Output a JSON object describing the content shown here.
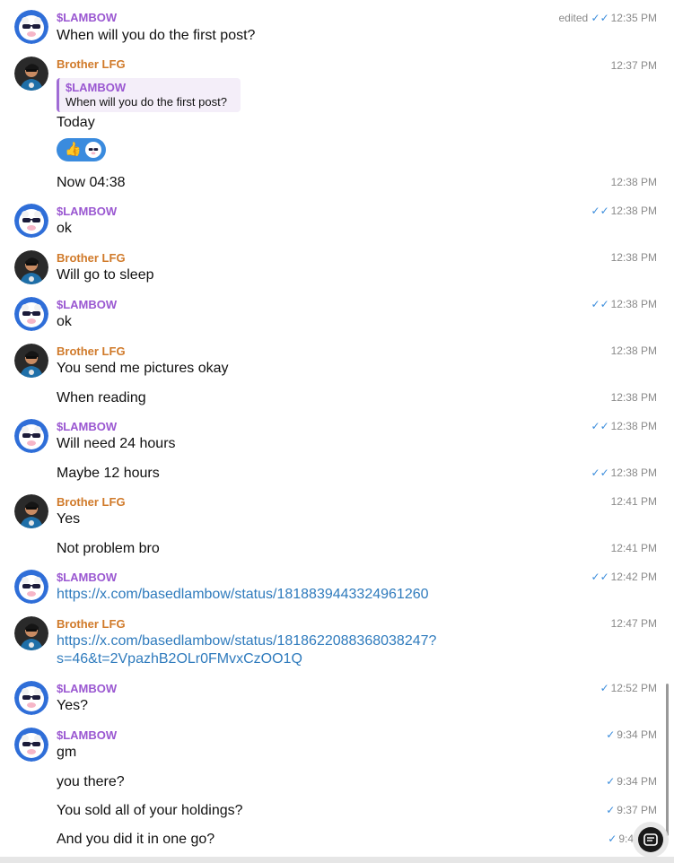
{
  "messages": [
    {
      "sender": "$LAMBOW",
      "text": "When will you do the first post?",
      "meta_prefix": "edited",
      "time": "12:35 PM",
      "check": "✓✓"
    },
    {
      "sender": "Brother LFG",
      "reply_sender": "$LAMBOW",
      "reply_text": "When will you do the first post?",
      "text": "Today",
      "time": "12:37 PM",
      "check": ""
    },
    {
      "text": "Now 04:38",
      "time": "12:38 PM",
      "check": ""
    },
    {
      "sender": "$LAMBOW",
      "text": "ok",
      "time": "12:38 PM",
      "check": "✓✓"
    },
    {
      "sender": "Brother LFG",
      "text": "Will go to sleep",
      "time": "12:38 PM",
      "check": ""
    },
    {
      "sender": "$LAMBOW",
      "text": "ok",
      "time": "12:38 PM",
      "check": "✓✓"
    },
    {
      "sender": "Brother LFG",
      "text": "You send me pictures okay",
      "time": "12:38 PM",
      "check": ""
    },
    {
      "text": "When reading",
      "time": "12:38 PM",
      "check": ""
    },
    {
      "sender": "$LAMBOW",
      "text": "Will need 24 hours",
      "time": "12:38 PM",
      "check": "✓✓"
    },
    {
      "text": "Maybe 12 hours",
      "time": "12:38 PM",
      "check": "✓✓"
    },
    {
      "sender": "Brother LFG",
      "text": "Yes",
      "time": "12:41 PM",
      "check": ""
    },
    {
      "text": "Not problem bro",
      "time": "12:41 PM",
      "check": ""
    },
    {
      "sender": "$LAMBOW",
      "text": "https://x.com/basedlambow/status/1818839443324961260",
      "time": "12:42 PM",
      "check": "✓✓"
    },
    {
      "sender": "Brother LFG",
      "text": "https://x.com/basedlambow/status/1818622088368038247?",
      "text2": "s=46&t=2VpazhB2OLr0FMvxCzOO1Q",
      "time": "12:47 PM",
      "check": ""
    },
    {
      "sender": "$LAMBOW",
      "text": "Yes?",
      "time": "12:52 PM",
      "check": "✓"
    },
    {
      "sender": "$LAMBOW",
      "text": "gm",
      "time": "9:34 PM",
      "check": "✓"
    },
    {
      "text": "you there?",
      "time": "9:34 PM",
      "check": "✓"
    },
    {
      "text": "You sold all of your holdings?",
      "time": "9:37 PM",
      "check": "✓"
    },
    {
      "text": "And you did it in one go?",
      "time": "9:4",
      "check": "✓"
    }
  ],
  "colors": {
    "lambow_name": "#9a57d1",
    "lfg_name": "#d07a2a",
    "link": "#2f7bbd",
    "check": "#3b8ddc",
    "reaction_bg": "#3a8bde"
  },
  "icons": {
    "lambow_avatar": "sheep-sunglasses-icon",
    "lfg_avatar": "person-avatar-icon",
    "reaction_1": "thumbs-up-icon",
    "reaction_2": "sheep-sunglasses-icon",
    "fab": "scroll-to-bottom-icon"
  }
}
